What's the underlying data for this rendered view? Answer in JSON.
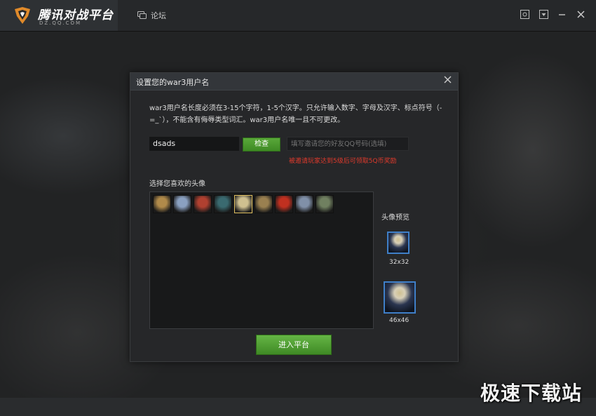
{
  "app": {
    "logo_text": "腾讯对战平台",
    "logo_sub": "DZ.QQ.COM",
    "forum_label": "论坛",
    "icons": [
      "logo-icon",
      "forum-icon",
      "settings-icon",
      "menu-dropdown-icon",
      "minimize-icon",
      "close-icon"
    ]
  },
  "dialog": {
    "title": "设置您的war3用户名",
    "description": "war3用户名长度必须在3-15个字符，1-5个汉字。只允许输入数字、字母及汉字、标点符号（-=_`），不能含有侮辱类型词汇。war3用户名唯一且不可更改。",
    "username_value": "dsads",
    "check_label": "检查",
    "invite_placeholder": "填写邀请您的好友QQ号码(选填)",
    "invite_note": "被邀请玩家达到5级后可领取5Q币奖励",
    "avatar_section_label": "选择您喜欢的头像",
    "avatars": [
      {
        "name": "avatar-1",
        "color": "#b08a4a"
      },
      {
        "name": "avatar-2",
        "color": "#8aa0c0"
      },
      {
        "name": "avatar-3",
        "color": "#b04030"
      },
      {
        "name": "avatar-4",
        "color": "#3a6a70"
      },
      {
        "name": "avatar-5",
        "color": "#cfc090",
        "selected": true
      },
      {
        "name": "avatar-6",
        "color": "#9a8050"
      },
      {
        "name": "avatar-7",
        "color": "#c03020"
      },
      {
        "name": "avatar-8",
        "color": "#8090a8"
      },
      {
        "name": "avatar-9",
        "color": "#708060"
      }
    ],
    "preview_label": "头像预览",
    "preview_small_label": "32x32",
    "preview_large_label": "46x46",
    "enter_label": "进入平台"
  },
  "watermark": "极速下载站",
  "colors": {
    "accent_green": "#4e9a30",
    "warning_red": "#e03a2c",
    "preview_border": "#3f7fc8"
  }
}
